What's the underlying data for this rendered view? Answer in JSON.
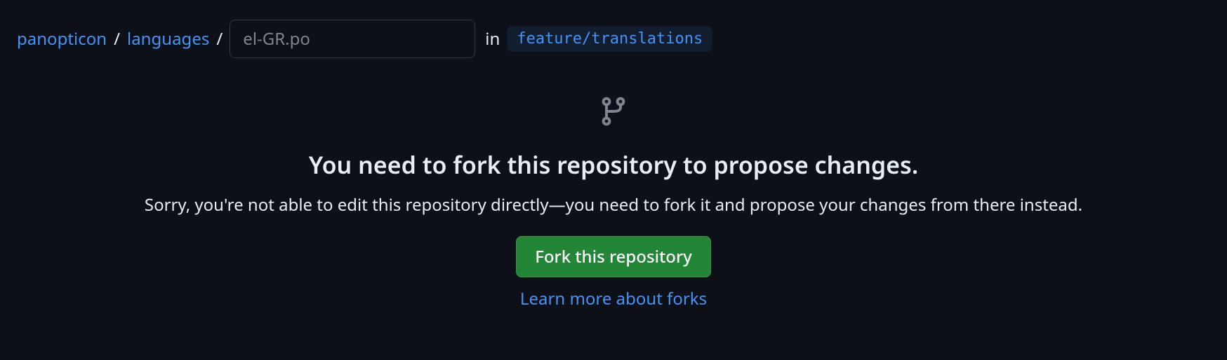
{
  "breadcrumb": {
    "repo": "panopticon",
    "folder": "languages",
    "separator": "/",
    "filename_value": "el-GR.po",
    "in_label": "in",
    "branch": "feature/translations"
  },
  "notice": {
    "heading": "You need to fork this repository to propose changes.",
    "subtext": "Sorry, you're not able to edit this repository directly—you need to fork it and propose your changes from there instead.",
    "fork_button": "Fork this repository",
    "learn_link": "Learn more about forks"
  }
}
